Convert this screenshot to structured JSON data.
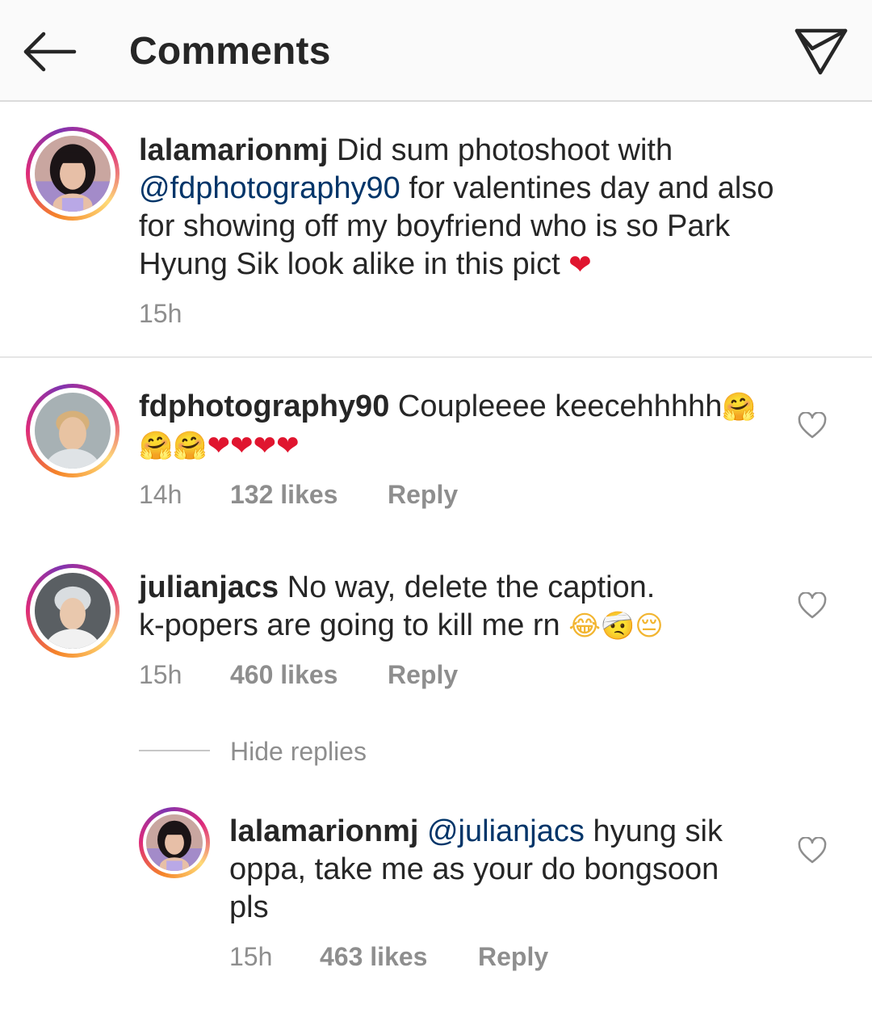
{
  "header": {
    "title": "Comments",
    "back_icon": "arrow-left-icon",
    "share_icon": "paper-plane-icon"
  },
  "caption": {
    "username": "lalamarionmj",
    "text_1": "Did sum photoshoot with",
    "mention": "@fdphotography90",
    "text_2": "for valentines day and also for showing off my boyfriend who is so Park Hyung Sik look alike in this pict",
    "emoji": "❤",
    "time": "15h"
  },
  "comments": [
    {
      "username": "fdphotography90",
      "text": "Coupleeee keecehhhhh",
      "emoji_line_1": "🤗",
      "emoji_line_2_hugs": "🤗🤗",
      "emoji_line_2_hearts": "❤❤❤❤",
      "time": "14h",
      "likes": "132 likes",
      "reply": "Reply"
    },
    {
      "username": "julianjacs",
      "text_1": "No way, delete the caption.",
      "text_2": "k-popers are going to kill me rn",
      "emojis": "😂🤕😔",
      "time": "15h",
      "likes": "460 likes",
      "reply": "Reply"
    }
  ],
  "hide_replies": "Hide replies",
  "reply": {
    "username": "lalamarionmj",
    "mention": "@julianjacs",
    "text": "hyung sik oppa, take me as your do bongsoon pls",
    "time": "15h",
    "likes": "463 likes",
    "reply": "Reply"
  },
  "colors": {
    "header_bg": "#fafafa",
    "text": "#262626",
    "meta": "#8e8e8e",
    "mention": "#003569",
    "heart": "#e0152f"
  }
}
